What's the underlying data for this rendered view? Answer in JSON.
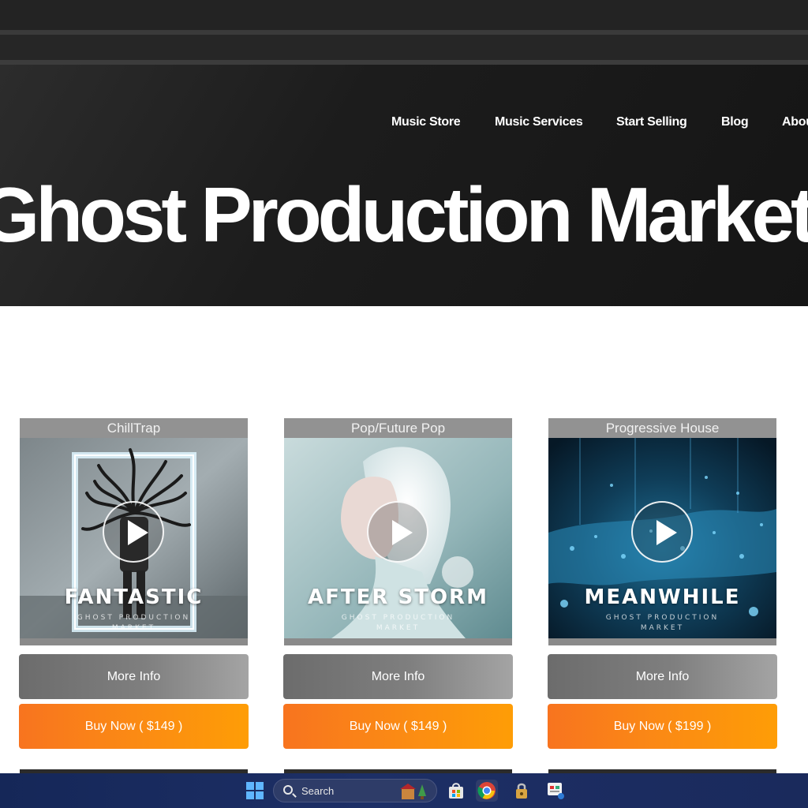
{
  "nav": {
    "items": [
      {
        "label": "Music Store"
      },
      {
        "label": "Music Services"
      },
      {
        "label": "Start Selling"
      },
      {
        "label": "Blog"
      },
      {
        "label": "About"
      }
    ]
  },
  "hero": {
    "title": "Ghost Production Market"
  },
  "products": [
    {
      "genre": "ChillTrap",
      "track": "FANTASTIC",
      "sub1": "GHOST PRODUCTION",
      "sub2": "MARKET",
      "more_info": "More Info",
      "buy": "Buy Now ( $149 )"
    },
    {
      "genre": "Pop/Future Pop",
      "track": "AFTER STORM",
      "sub1": "GHOST PRODUCTION",
      "sub2": "MARKET",
      "more_info": "More Info",
      "buy": "Buy Now ( $149 )"
    },
    {
      "genre": "Progressive House",
      "track": "MEANWHILE",
      "sub1": "GHOST PRODUCTION",
      "sub2": "MARKET",
      "more_info": "More Info",
      "buy": "Buy Now ( $199 )"
    }
  ],
  "taskbar": {
    "search_label": "Search",
    "icons": [
      "windows-start-icon",
      "store-icon",
      "chrome-icon",
      "security-icon",
      "app-icon"
    ]
  },
  "colors": {
    "hero_bg": "#1c1c1c",
    "buy_orange": "#fb8a14",
    "more_info_gray": "#7f7f7f",
    "taskbar_blue": "#1d2f66"
  }
}
